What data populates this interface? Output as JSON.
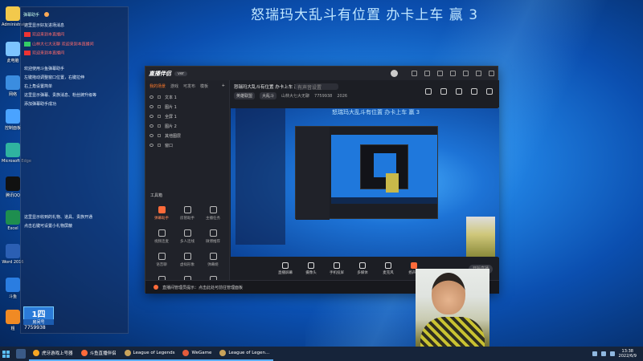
{
  "overlay_title": "怒瑞玛大乱斗有位置  办卡上车   赢 3",
  "desktop_icons": [
    {
      "label": "Administrator",
      "color": "#f2c94c"
    },
    {
      "label": "此电脑",
      "color": "#7cc4ff"
    },
    {
      "label": "网络",
      "color": "#3b8de0"
    },
    {
      "label": "控制面板",
      "color": "#4aa3ff"
    },
    {
      "label": "Microsoft Edge",
      "color": "#2fb3a0"
    },
    {
      "label": "腾讯QQ",
      "color": "#111111"
    },
    {
      "label": "Excel",
      "color": "#1e8e4f"
    },
    {
      "label": "Word 2016",
      "color": "#2b5fb3"
    },
    {
      "label": "斗鱼",
      "color": "#2a7de1"
    },
    {
      "label": "粗",
      "color": "#f08a24"
    }
  ],
  "chat": {
    "header": [
      "弹幕助手",
      "",
      ""
    ],
    "lines": [
      {
        "text": "这里显示好友进场消息",
        "type": "sys"
      },
      {
        "text": "欢迎来到本直播间",
        "tag": "r"
      },
      {
        "text": "山林大七大无聊  欢迎来到本直播间",
        "tag": "g"
      },
      {
        "text": "欢迎来到本直播间",
        "tag": "r"
      },
      {
        "text": "欢迎使用斗鱼弹幕助手",
        "type": "sys",
        "gap": true
      },
      {
        "text": "左键拖动调整窗口位置，右键拉伸",
        "type": "sys"
      },
      {
        "text": "右上角设置简单",
        "type": "sys"
      },
      {
        "text": "这里显示弹幕、贵族消息、粉丝牌升级等",
        "type": "sys"
      },
      {
        "text": "添加弹幕助手成功",
        "type": "sys"
      },
      {
        "text": "这里显示收到的礼物、道具、贵族开通",
        "type": "sys",
        "gap": true
      },
      {
        "text": "点击右键可设置小礼物屏蔽",
        "type": "sys"
      }
    ],
    "fan_badge": "1四",
    "fan_sub": "房间号",
    "room_id": "7759938"
  },
  "app": {
    "logo": "直播伴侣",
    "logo_badge": "ver",
    "scene_tabs": [
      "我的场景",
      "游戏",
      "可发布",
      "模板"
    ],
    "layers": [
      "文本 1",
      "图片 1",
      "全屏 1",
      "图片 2",
      "其他图层",
      "窗口"
    ],
    "tool_title": "工具箱",
    "tools": [
      {
        "label": "弹幕助手",
        "hot": true
      },
      {
        "label": "房管助手"
      },
      {
        "label": "主播任务"
      },
      {
        "label": "视频连麦"
      },
      {
        "label": "多人连线"
      },
      {
        "label": "微博推荐"
      },
      {
        "label": "语音聊"
      },
      {
        "label": "虚拟形象"
      },
      {
        "label": "弹幕姬"
      },
      {
        "label": "更多"
      },
      {
        "label": "特效"
      },
      {
        "label": "设置"
      }
    ],
    "room_title": "怒瑞玛大乱斗有位置 办卡上车 赢 3",
    "room_meta": [
      "英雄联盟",
      "大乱斗",
      "山林大七大无聊",
      "7759938",
      "2026"
    ],
    "room_input_placeholder": "有声音设置",
    "preview_title": "怒瑞玛大乱斗有位置  办卡上车   赢 3",
    "bottom_items": [
      {
        "label": "直播屏幕"
      },
      {
        "label": "摄像头"
      },
      {
        "label": "手机投屏"
      },
      {
        "label": "多媒体"
      },
      {
        "label": "麦克风"
      },
      {
        "label": "扬声器",
        "hot": true
      }
    ],
    "start_live": "开始直播",
    "notice": "直播间管理员提示：点击此处可前往管理面板"
  },
  "taskbar": {
    "tasks": [
      {
        "label": "虎牙游戏上号器",
        "color": "#f5a623"
      },
      {
        "label": "斗鱼直播伴侣",
        "color": "#ff6b3a"
      },
      {
        "label": "League of Legends",
        "color": "#c9a35a"
      },
      {
        "label": "WeGame",
        "color": "#e55b3c"
      },
      {
        "label": "League of Legen...",
        "color": "#c9a35a"
      }
    ],
    "time": "13:38",
    "date": "2022/6/9"
  }
}
